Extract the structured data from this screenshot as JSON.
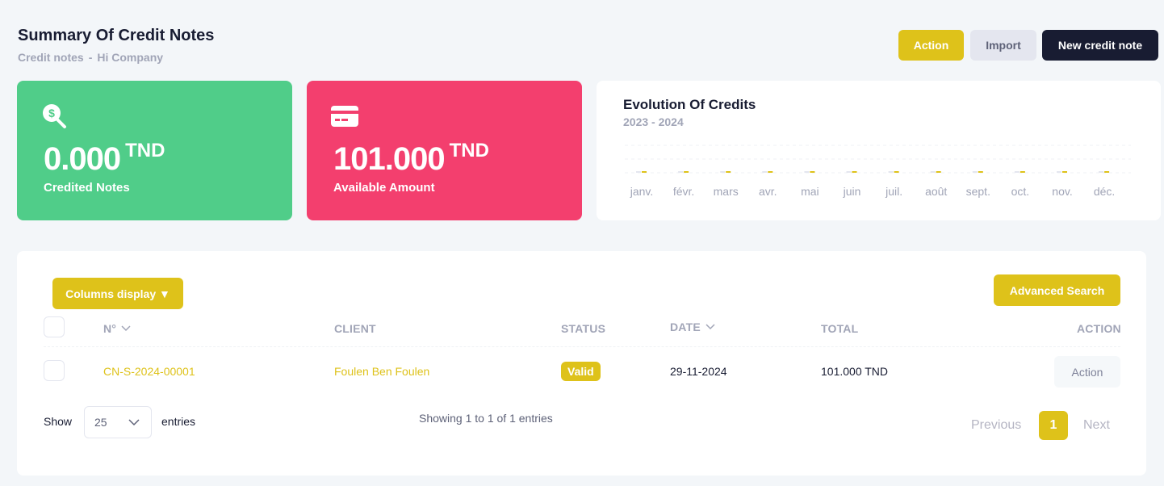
{
  "header": {
    "title": "Summary Of Credit Notes",
    "breadcrumb": [
      "Credit notes",
      "Hi Company"
    ],
    "breadcrumb_sep": "-"
  },
  "toolbar": {
    "action_label": "Action",
    "import_label": "Import",
    "new_label": "New credit note"
  },
  "stats": {
    "credited": {
      "value": "0.000",
      "unit": "TND",
      "label": "Credited Notes",
      "icon": "search-dollar-icon"
    },
    "available": {
      "value": "101.000",
      "unit": "TND",
      "label": "Available Amount",
      "icon": "credit-card-icon"
    }
  },
  "chart": {
    "title": "Evolution Of Credits",
    "subtitle": "2023 - 2024"
  },
  "chart_data": {
    "type": "bar",
    "title": "Evolution Of Credits",
    "categories": [
      "janv.",
      "févr.",
      "mars",
      "avr.",
      "mai",
      "juin",
      "juil.",
      "août",
      "sept.",
      "oct.",
      "nov.",
      "déc."
    ],
    "series": [
      {
        "values": [
          0,
          0,
          0,
          0,
          0,
          0,
          0,
          0,
          0,
          0,
          0,
          0
        ],
        "color": "#dec21a"
      },
      {
        "values": [
          0,
          0,
          0,
          0,
          0,
          0,
          0,
          0,
          0,
          0,
          0,
          0
        ],
        "color": "#e4e6ef"
      }
    ],
    "grid": true
  },
  "table": {
    "columns_button": "Columns display ▼",
    "advanced_search": "Advanced Search",
    "headers": {
      "number": "N°",
      "client": "CLIENT",
      "status": "STATUS",
      "date": "DATE",
      "total": "TOTAL",
      "action": "ACTION"
    },
    "rows": [
      {
        "number": "CN-S-2024-00001",
        "client": "Foulen Ben Foulen",
        "status": "Valid",
        "date": "29-11-2024",
        "total": "101.000 TND",
        "action": "Action"
      }
    ]
  },
  "footer": {
    "show_label": "Show",
    "page_size": "25",
    "entries_label": "entries",
    "showing_text": "Showing 1 to 1 of 1 entries",
    "prev_label": "Previous",
    "current_page": "1",
    "next_label": "Next"
  },
  "colors": {
    "accent": "#dec21a",
    "green": "#50cd89",
    "red": "#f33f6e",
    "dark": "#181c32"
  }
}
